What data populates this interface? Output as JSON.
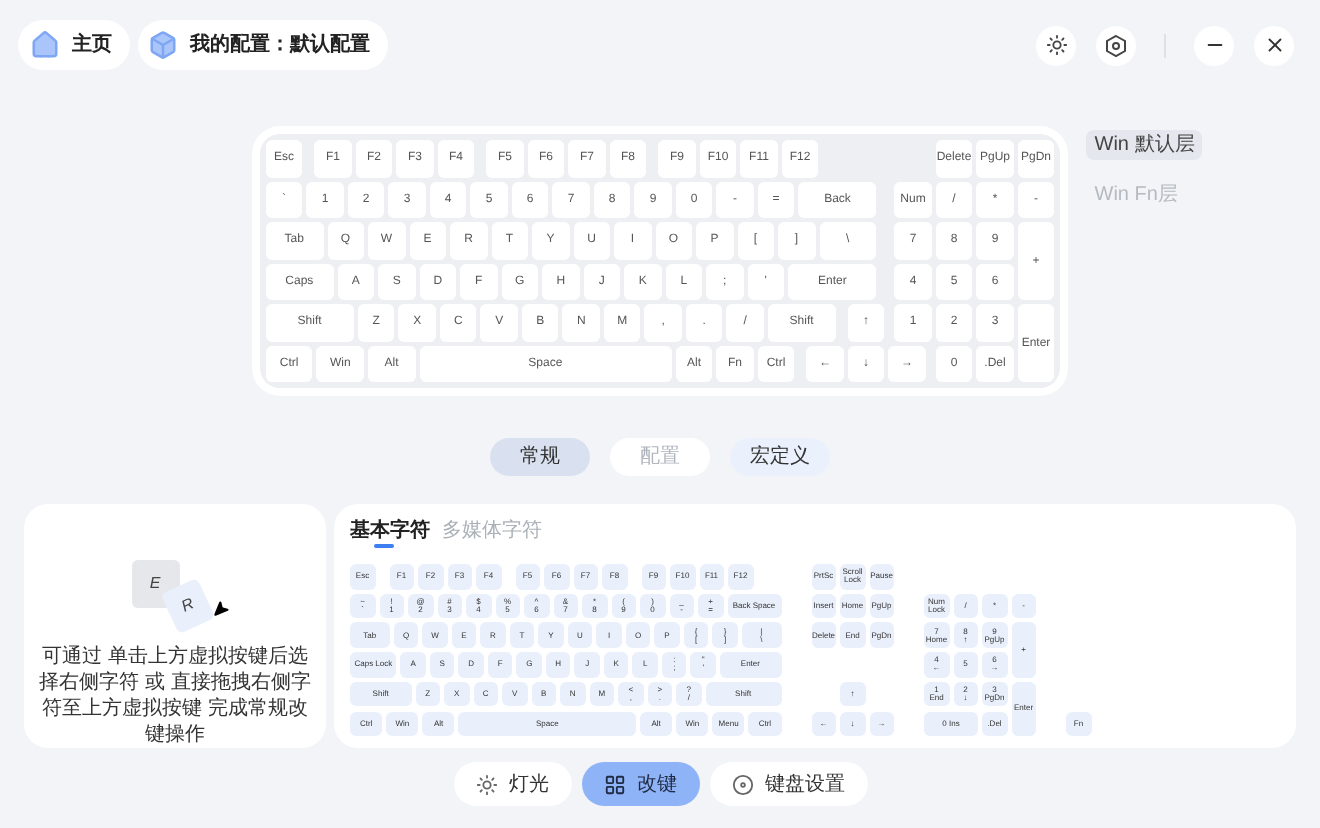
{
  "header": {
    "home": "主页",
    "profile": "我的配置：默认配置"
  },
  "layers": [
    {
      "label": "Win 默认层",
      "selected": true
    },
    {
      "label": "Win Fn层",
      "selected": false
    }
  ],
  "keyboard": {
    "blocks": [
      {
        "kind": "main",
        "sections": [
          [
            [
              [
                {
                  "label": "Esc",
                  "kind": "u1"
                }
              ],
              [
                {
                  "label": "F1",
                  "kind": "u1"
                },
                {
                  "label": "F2",
                  "kind": "u1"
                },
                {
                  "label": "F3",
                  "kind": "u1"
                },
                {
                  "label": "F4",
                  "kind": "u1"
                }
              ],
              [
                {
                  "label": "F5",
                  "kind": "u1"
                },
                {
                  "label": "F6",
                  "kind": "u1"
                },
                {
                  "label": "F7",
                  "kind": "u1"
                },
                {
                  "label": "F8",
                  "kind": "u1"
                }
              ],
              [
                {
                  "label": "F9",
                  "kind": "u1"
                },
                {
                  "label": "F10",
                  "kind": "u1"
                },
                {
                  "label": "F11",
                  "kind": "u1"
                },
                {
                  "label": "F12",
                  "kind": "u1"
                }
              ]
            ],
            [
              [
                {
                  "label": "`",
                  "kind": "u1"
                },
                {
                  "label": "1",
                  "kind": "u1"
                },
                {
                  "label": "2",
                  "kind": "u1"
                },
                {
                  "label": "3",
                  "kind": "u1"
                },
                {
                  "label": "4",
                  "kind": "u1"
                },
                {
                  "label": "5",
                  "kind": "u1"
                },
                {
                  "label": "6",
                  "kind": "u1"
                },
                {
                  "label": "7",
                  "kind": "u1"
                },
                {
                  "label": "8",
                  "kind": "u1"
                },
                {
                  "label": "9",
                  "kind": "u1"
                },
                {
                  "label": "0",
                  "kind": "u1"
                },
                {
                  "label": "-",
                  "kind": "u1"
                },
                {
                  "label": "=",
                  "kind": "u1"
                },
                {
                  "label": "Back",
                  "kind": "u2"
                }
              ]
            ],
            [
              [
                {
                  "label": "Tab",
                  "kind": "u1_5"
                },
                {
                  "label": "Q",
                  "kind": "u1"
                },
                {
                  "label": "W",
                  "kind": "u1"
                },
                {
                  "label": "E",
                  "kind": "u1"
                },
                {
                  "label": "R",
                  "kind": "u1"
                },
                {
                  "label": "T",
                  "kind": "u1"
                },
                {
                  "label": "Y",
                  "kind": "u1"
                },
                {
                  "label": "U",
                  "kind": "u1"
                },
                {
                  "label": "I",
                  "kind": "u1"
                },
                {
                  "label": "O",
                  "kind": "u1"
                },
                {
                  "label": "P",
                  "kind": "u1"
                },
                {
                  "label": "[",
                  "kind": "u1"
                },
                {
                  "label": "]",
                  "kind": "u1"
                },
                {
                  "label": "\\",
                  "kind": "u1_5"
                }
              ]
            ],
            [
              [
                {
                  "label": "Caps",
                  "kind": "u1_75"
                },
                {
                  "label": "A",
                  "kind": "u1"
                },
                {
                  "label": "S",
                  "kind": "u1"
                },
                {
                  "label": "D",
                  "kind": "u1"
                },
                {
                  "label": "F",
                  "kind": "u1"
                },
                {
                  "label": "G",
                  "kind": "u1"
                },
                {
                  "label": "H",
                  "kind": "u1"
                },
                {
                  "label": "J",
                  "kind": "u1"
                },
                {
                  "label": "K",
                  "kind": "u1"
                },
                {
                  "label": "L",
                  "kind": "u1"
                },
                {
                  "label": ";",
                  "kind": "u1"
                },
                {
                  "label": "'",
                  "kind": "u1"
                },
                {
                  "label": "Enter",
                  "kind": "u2_25"
                }
              ]
            ],
            [
              [
                {
                  "label": "Shift",
                  "kind": "u2_25"
                },
                {
                  "label": "Z",
                  "kind": "u1"
                },
                {
                  "label": "X",
                  "kind": "u1"
                },
                {
                  "label": "C",
                  "kind": "u1"
                },
                {
                  "label": "V",
                  "kind": "u1"
                },
                {
                  "label": "B",
                  "kind": "u1"
                },
                {
                  "label": "N",
                  "kind": "u1"
                },
                {
                  "label": "M",
                  "kind": "u1"
                },
                {
                  "label": ",",
                  "kind": "u1"
                },
                {
                  "label": ".",
                  "kind": "u1"
                },
                {
                  "label": "/",
                  "kind": "u1"
                },
                {
                  "label": "Shift",
                  "kind": "u1_75"
                }
              ],
              [
                {
                  "label": "↑",
                  "kind": "u1"
                }
              ]
            ],
            [
              [
                {
                  "label": "Ctrl",
                  "kind": "u1_25"
                },
                {
                  "label": "Win",
                  "kind": "u1_25"
                },
                {
                  "label": "Alt",
                  "kind": "u1_25"
                },
                {
                  "label": "Space",
                  "kind": "u6_25"
                },
                {
                  "label": "Alt",
                  "kind": "u1"
                },
                {
                  "label": "Fn",
                  "kind": "u1"
                },
                {
                  "label": "Ctrl",
                  "kind": "u1"
                }
              ],
              [
                {
                  "label": "←",
                  "kind": "u1"
                },
                {
                  "label": "↓",
                  "kind": "u1"
                },
                {
                  "label": "→",
                  "kind": "u1"
                }
              ]
            ]
          ]
        ]
      },
      {
        "kind": "numpad",
        "sections": [
          [
            [
              [
                {
                  "label": "Delete",
                  "kind": "u1"
                },
                {
                  "label": "PgUp",
                  "kind": "u1"
                },
                {
                  "label": "PgDn",
                  "kind": "u1"
                }
              ]
            ],
            [
              [
                {
                  "label": "Num",
                  "kind": "u1"
                },
                {
                  "label": "/",
                  "kind": "u1"
                },
                {
                  "label": "*",
                  "kind": "u1"
                },
                {
                  "label": "-",
                  "kind": "u1"
                }
              ]
            ],
            [
              [
                {
                  "label": "7",
                  "kind": "u1"
                },
                {
                  "label": "8",
                  "kind": "u1"
                },
                {
                  "label": "9",
                  "kind": "u1"
                },
                {
                  "label": "+",
                  "kind": "tall"
                }
              ]
            ],
            [
              [
                {
                  "label": "4",
                  "kind": "u1"
                },
                {
                  "label": "5",
                  "kind": "u1"
                },
                {
                  "label": "6",
                  "kind": "u1"
                }
              ]
            ],
            [
              [
                {
                  "label": "1",
                  "kind": "u1"
                },
                {
                  "label": "2",
                  "kind": "u1"
                },
                {
                  "label": "3",
                  "kind": "u1"
                },
                {
                  "label": "Enter",
                  "kind": "tall"
                }
              ]
            ],
            [
              [
                {
                  "label": "0",
                  "kind": "u1"
                },
                {
                  "label": ".Del",
                  "kind": "u1"
                }
              ]
            ]
          ]
        ]
      }
    ]
  },
  "mode_tabs": [
    {
      "label": "常规",
      "selected": true,
      "disabled": false
    },
    {
      "label": "配置",
      "selected": false,
      "disabled": true
    },
    {
      "label": "宏定义",
      "selected": false,
      "disabled": false
    }
  ],
  "hint": {
    "keys": [
      "E",
      "R"
    ],
    "text": "可通过 单击上方虚拟按键后选择右侧字符 或 直接拖拽右侧字符至上方虚拟按键 完成常规改键操作"
  },
  "char_tabs": [
    {
      "label": "基本字符",
      "selected": true
    },
    {
      "label": "多媒体字符",
      "selected": false
    }
  ],
  "char_keyboard": {
    "blocks": [
      {
        "kind": "main",
        "sections": [
          [
            [
              [
                {
                  "label": "Esc",
                  "kind": "u1"
                }
              ],
              [
                {
                  "label": "F1",
                  "kind": "u1"
                },
                {
                  "label": "F2",
                  "kind": "u1"
                },
                {
                  "label": "F3",
                  "kind": "u1"
                },
                {
                  "label": "F4",
                  "kind": "u1"
                }
              ],
              [
                {
                  "label": "F5",
                  "kind": "u1"
                },
                {
                  "label": "F6",
                  "kind": "u1"
                },
                {
                  "label": "F7",
                  "kind": "u1"
                },
                {
                  "label": "F8",
                  "kind": "u1"
                }
              ],
              [
                {
                  "label": "F9",
                  "kind": "u1"
                },
                {
                  "label": "F10",
                  "kind": "u1"
                },
                {
                  "label": "F11",
                  "kind": "u1"
                },
                {
                  "label": "F12",
                  "kind": "u1"
                }
              ]
            ],
            [
              [
                {
                  "label": "~",
                  "sub": "`",
                  "kind": "u1"
                },
                {
                  "label": "!",
                  "sub": "1",
                  "kind": "u1"
                },
                {
                  "label": "@",
                  "sub": "2",
                  "kind": "u1"
                },
                {
                  "label": "#",
                  "sub": "3",
                  "kind": "u1"
                },
                {
                  "label": "$",
                  "sub": "4",
                  "kind": "u1"
                },
                {
                  "label": "%",
                  "sub": "5",
                  "kind": "u1"
                },
                {
                  "label": "^",
                  "sub": "6",
                  "kind": "u1"
                },
                {
                  "label": "&",
                  "sub": "7",
                  "kind": "u1"
                },
                {
                  "label": "*",
                  "sub": "8",
                  "kind": "u1"
                },
                {
                  "label": "(",
                  "sub": "9",
                  "kind": "u1"
                },
                {
                  "label": ")",
                  "sub": "0",
                  "kind": "u1"
                },
                {
                  "label": "_",
                  "sub": "-",
                  "kind": "u1"
                },
                {
                  "label": "+",
                  "sub": "=",
                  "kind": "u1"
                },
                {
                  "label": "Back Space",
                  "kind": "u2"
                }
              ]
            ],
            [
              [
                {
                  "label": "Tab",
                  "kind": "u1_5"
                },
                {
                  "label": "Q",
                  "kind": "u1"
                },
                {
                  "label": "W",
                  "kind": "u1"
                },
                {
                  "label": "E",
                  "kind": "u1"
                },
                {
                  "label": "R",
                  "kind": "u1"
                },
                {
                  "label": "T",
                  "kind": "u1"
                },
                {
                  "label": "Y",
                  "kind": "u1"
                },
                {
                  "label": "U",
                  "kind": "u1"
                },
                {
                  "label": "I",
                  "kind": "u1"
                },
                {
                  "label": "O",
                  "kind": "u1"
                },
                {
                  "label": "P",
                  "kind": "u1"
                },
                {
                  "label": "{",
                  "sub": "[",
                  "kind": "u1"
                },
                {
                  "label": "}",
                  "sub": "]",
                  "kind": "u1"
                },
                {
                  "label": "|",
                  "sub": "\\",
                  "kind": "u1_5"
                }
              ]
            ],
            [
              [
                {
                  "label": "Caps Lock",
                  "kind": "u1_75"
                },
                {
                  "label": "A",
                  "kind": "u1"
                },
                {
                  "label": "S",
                  "kind": "u1"
                },
                {
                  "label": "D",
                  "kind": "u1"
                },
                {
                  "label": "F",
                  "kind": "u1"
                },
                {
                  "label": "G",
                  "kind": "u1"
                },
                {
                  "label": "H",
                  "kind": "u1"
                },
                {
                  "label": "J",
                  "kind": "u1"
                },
                {
                  "label": "K",
                  "kind": "u1"
                },
                {
                  "label": "L",
                  "kind": "u1"
                },
                {
                  "label": ":",
                  "sub": ";",
                  "kind": "u1"
                },
                {
                  "label": "\"",
                  "sub": "'",
                  "kind": "u1"
                },
                {
                  "label": "Enter",
                  "kind": "u2_25"
                }
              ]
            ],
            [
              [
                {
                  "label": "Shift",
                  "kind": "u2_25"
                },
                {
                  "label": "Z",
                  "kind": "u1"
                },
                {
                  "label": "X",
                  "kind": "u1"
                },
                {
                  "label": "C",
                  "kind": "u1"
                },
                {
                  "label": "V",
                  "kind": "u1"
                },
                {
                  "label": "B",
                  "kind": "u1"
                },
                {
                  "label": "N",
                  "kind": "u1"
                },
                {
                  "label": "M",
                  "kind": "u1"
                },
                {
                  "label": "<",
                  "sub": ",",
                  "kind": "u1"
                },
                {
                  "label": ">",
                  "sub": ".",
                  "kind": "u1"
                },
                {
                  "label": "?",
                  "sub": "/",
                  "kind": "u1"
                },
                {
                  "label": "Shift",
                  "kind": "u2_75"
                }
              ]
            ],
            [
              [
                {
                  "label": "Ctrl",
                  "kind": "u1_25"
                },
                {
                  "label": "Win",
                  "kind": "u1_25"
                },
                {
                  "label": "Alt",
                  "kind": "u1_25"
                },
                {
                  "label": "Space",
                  "kind": "u6_25"
                },
                {
                  "label": "Alt",
                  "kind": "u1_25"
                },
                {
                  "label": "Win",
                  "kind": "u1_25"
                },
                {
                  "label": "Menu",
                  "kind": "u1_25"
                },
                {
                  "label": "Ctrl",
                  "kind": "u1_25"
                }
              ]
            ]
          ]
        ]
      },
      {
        "kind": "nav",
        "sections": [
          [
            [
              [
                {
                  "label": "PrtSc",
                  "kind": "u1"
                },
                {
                  "label": "Scroll Lock",
                  "kind": "u1"
                },
                {
                  "label": "Pause",
                  "kind": "u1"
                }
              ]
            ],
            [
              [
                {
                  "label": "Insert",
                  "kind": "u1"
                },
                {
                  "label": "Home",
                  "kind": "u1"
                },
                {
                  "label": "PgUp",
                  "kind": "u1"
                }
              ]
            ],
            [
              [
                {
                  "label": "Delete",
                  "kind": "u1"
                },
                {
                  "label": "End",
                  "kind": "u1"
                },
                {
                  "label": "PgDn",
                  "kind": "u1"
                }
              ]
            ]
          ],
          [
            [
              [
                {
                  "label": "↑",
                  "kind": "u1"
                }
              ]
            ],
            [
              [
                {
                  "label": "←",
                  "kind": "u1"
                },
                {
                  "label": "↓",
                  "kind": "u1"
                },
                {
                  "label": "→",
                  "kind": "u1"
                }
              ]
            ]
          ]
        ]
      },
      {
        "kind": "numpad",
        "sections": [
          [
            [
              [
                {
                  "label": "Num Lock",
                  "kind": "u1"
                },
                {
                  "label": "/",
                  "kind": "u1"
                },
                {
                  "label": "*",
                  "kind": "u1"
                },
                {
                  "label": "-",
                  "kind": "u1"
                }
              ]
            ],
            [
              [
                {
                  "label": "7",
                  "sub": "Home",
                  "kind": "u1"
                },
                {
                  "label": "8",
                  "sub": "↑",
                  "kind": "u1"
                },
                {
                  "label": "9",
                  "sub": "PgUp",
                  "kind": "u1"
                },
                {
                  "label": "+",
                  "kind": "tall"
                }
              ]
            ],
            [
              [
                {
                  "label": "4",
                  "sub": "←",
                  "kind": "u1"
                },
                {
                  "label": "5",
                  "kind": "u1"
                },
                {
                  "label": "6",
                  "sub": "→",
                  "kind": "u1"
                }
              ]
            ],
            [
              [
                {
                  "label": "1",
                  "sub": "End",
                  "kind": "u1"
                },
                {
                  "label": "2",
                  "sub": "↓",
                  "kind": "u1"
                },
                {
                  "label": "3",
                  "sub": "PgDn",
                  "kind": "u1"
                },
                {
                  "label": "Enter",
                  "kind": "tall"
                }
              ]
            ],
            [
              [
                {
                  "label": "0 Ins",
                  "kind": "u2"
                },
                {
                  "label": ".Del",
                  "kind": "u1"
                }
              ]
            ]
          ]
        ]
      },
      {
        "kind": "extra",
        "sections": [
          [
            [
              [
                {
                  "label": "Fn",
                  "kind": "u1"
                }
              ]
            ]
          ]
        ]
      }
    ]
  },
  "toolbar": [
    {
      "label": "灯光",
      "kind": "light",
      "selected": false
    },
    {
      "label": "改键",
      "kind": "remap",
      "selected": true
    },
    {
      "label": "键盘设置",
      "kind": "settings",
      "selected": false
    }
  ]
}
